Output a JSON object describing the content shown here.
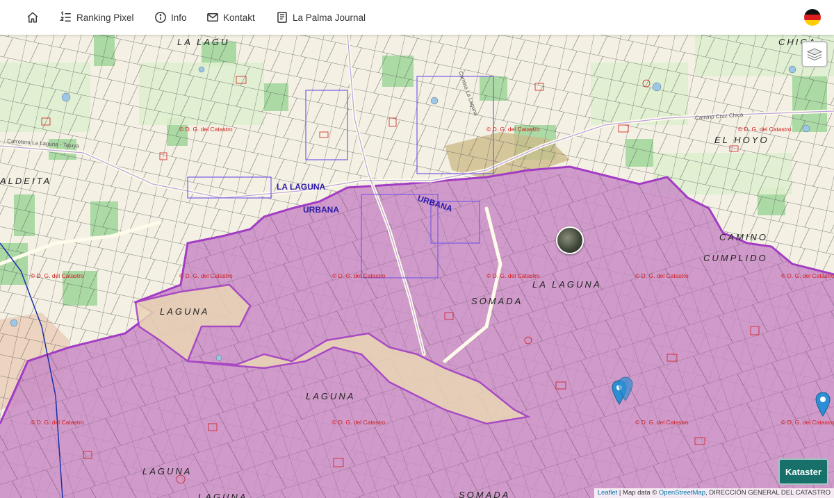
{
  "nav": {
    "home_icon": "home-icon",
    "ranking_label": "Ranking Pixel",
    "info_label": "Info",
    "kontakt_label": "Kontakt",
    "journal_label": "La Palma Journal",
    "language_flag": "german-flag-icon"
  },
  "map": {
    "place_labels": [
      "LA LAGU",
      "CHICA",
      "EL HOYO",
      "ALDEITA",
      "LA LAGUNA",
      "CAMINO",
      "CUMPLIDO",
      "LAGUNA",
      "LAGUNA",
      "SOMADA",
      "LAGUNA",
      "LAGUNA",
      "SOMADA"
    ],
    "urban_labels": [
      "LA LAGUNA",
      "URBANA",
      "URBANA"
    ],
    "catastro_watermark": "© D. G. del Catastro",
    "road_labels": [
      "Camino Cruz Chica",
      "Camino La Laguna",
      "Carretera La Laguna - Tajuya"
    ],
    "colors": {
      "zone_fill": "#c98cc5",
      "zone_border": "#a23cc4",
      "parcel_line": "#555555",
      "catastro_red": "#d21a1a",
      "urban_blue": "#7a5ae6",
      "field_green": "#9fd39a",
      "base": "#f4f1e4"
    }
  },
  "controls": {
    "layers_icon": "layers-icon",
    "kataster_label": "Kataster"
  },
  "attribution": {
    "leaflet": "Leaflet",
    "sep": " | Map data © ",
    "osm": "OpenStreetMap",
    "rest": ", DIRECCIÓN GENERAL DEL CATASTRO"
  }
}
